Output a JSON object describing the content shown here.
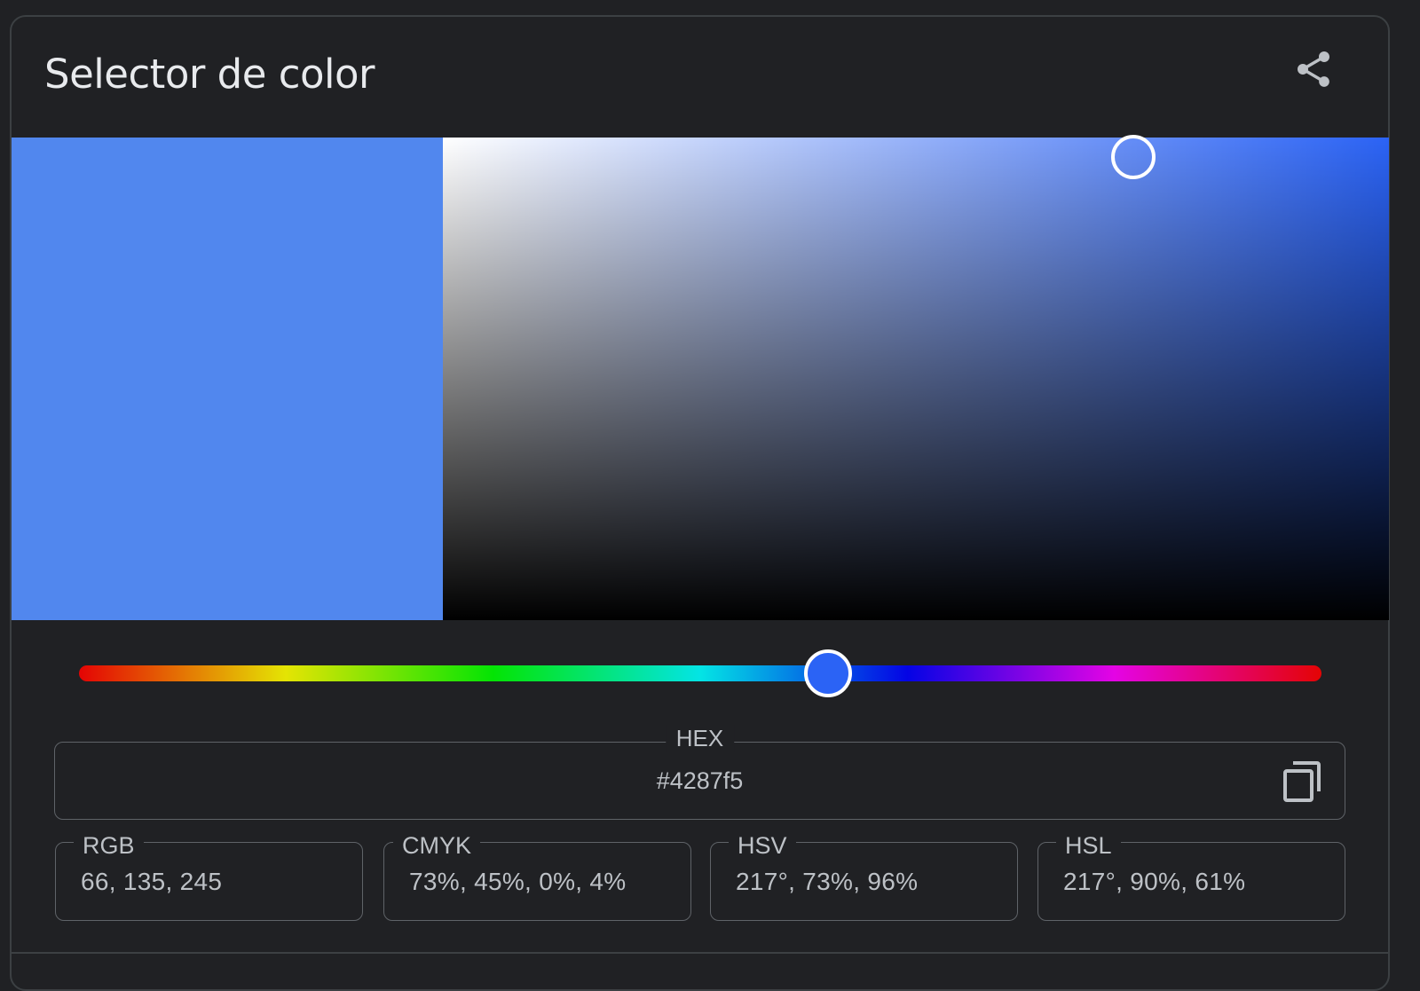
{
  "widget": {
    "title": "Selector de color",
    "share_icon": "share-icon"
  },
  "color": {
    "swatch_color": "#5187ee",
    "hue_color": "#2b63f5",
    "hue_fraction": 0.603,
    "saturation": 0.73,
    "value": 0.96
  },
  "hex": {
    "label": "HEX",
    "value": "#4287f5",
    "copy_icon": "copy-icon"
  },
  "formats": [
    {
      "label": "RGB",
      "value": "66, 135, 245"
    },
    {
      "label": "CMYK",
      "value": "73%, 45%, 0%, 4%"
    },
    {
      "label": "HSV",
      "value": "217°, 73%, 96%"
    },
    {
      "label": "HSL",
      "value": "217°, 90%, 61%"
    }
  ]
}
